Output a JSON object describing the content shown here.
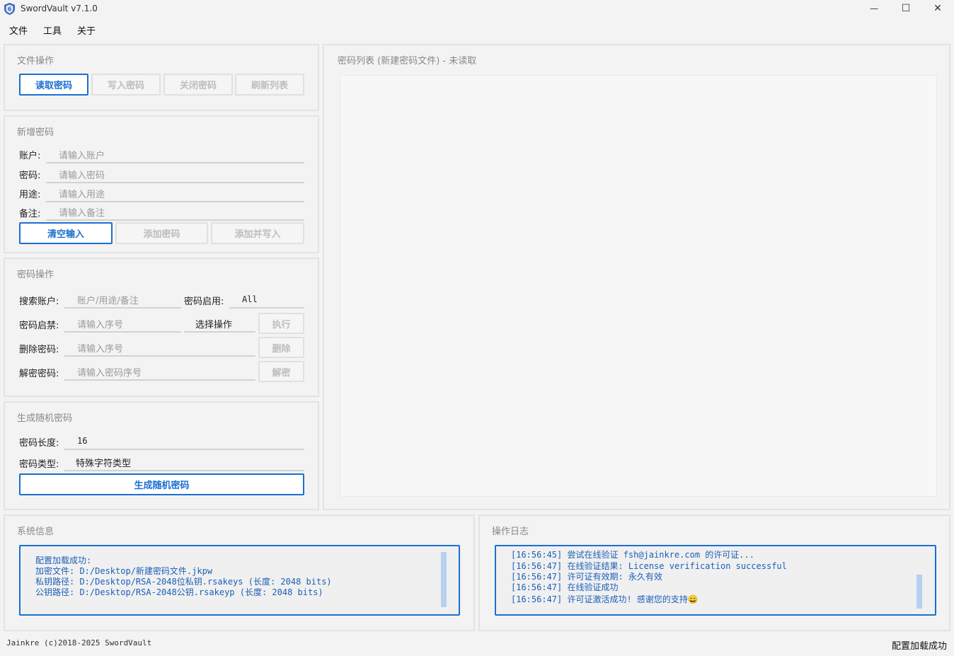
{
  "window": {
    "title": "SwordVault v7.1.0",
    "minimize": "—",
    "maximize": "☐",
    "close": "✕"
  },
  "menu": [
    "文件",
    "工具",
    "关于"
  ],
  "file_ops": {
    "title": "文件操作",
    "buttons": [
      "读取密码",
      "写入密码",
      "关闭密码",
      "刷新列表"
    ]
  },
  "new_password": {
    "title": "新增密码",
    "fields": [
      {
        "label": "账户:",
        "placeholder": "请输入账户"
      },
      {
        "label": "密码:",
        "placeholder": "请输入密码"
      },
      {
        "label": "用途:",
        "placeholder": "请输入用途"
      },
      {
        "label": "备注:",
        "placeholder": "请输入备注"
      }
    ],
    "buttons": [
      "清空输入",
      "添加密码",
      "添加并写入"
    ]
  },
  "password_ops": {
    "title": "密码操作",
    "search_label": "搜索账户:",
    "search_placeholder": "账户/用途/备注",
    "enable_label": "密码启用:",
    "enable_value": "All",
    "toggle_label": "密码启禁:",
    "toggle_placeholder": "请输入序号",
    "select_action": "选择操作",
    "execute": "执行",
    "delete_label": "删除密码:",
    "delete_placeholder": "请输入序号",
    "delete_button": "删除",
    "decrypt_label": "解密密码:",
    "decrypt_placeholder": "请输入密码序号",
    "decrypt_button": "解密"
  },
  "random_password": {
    "title": "生成随机密码",
    "length_label": "密码长度:",
    "length_value": "16",
    "type_label": "密码类型:",
    "type_value": "特殊字符类型",
    "generate": "生成随机密码"
  },
  "password_list": {
    "title": "密码列表 (新建密码文件) - 未读取"
  },
  "system_info": {
    "title": "系统信息",
    "lines": [
      "配置加载成功:",
      "加密文件: D:/Desktop/新建密码文件.jkpw",
      "私钥路径: D:/Desktop/RSA-2048位私钥.rsakeys (长度: 2048 bits)",
      "公钥路径: D:/Desktop/RSA-2048公钥.rsakeyp (长度: 2048 bits)"
    ]
  },
  "operation_log": {
    "title": "操作日志",
    "lines": [
      "[16:56:45] 尝试在线验证 fsh@jainkre.com 的许可证...",
      "[16:56:47] 在线验证结果: License verification successful",
      "[16:56:47] 许可证有效期: 永久有效",
      "[16:56:47] 在线验证成功",
      "[16:56:47] 许可证激活成功! 感谢您的支持😄"
    ]
  },
  "status": {
    "copyright": "Jainkre (c)2018-2025 SwordVault",
    "message": "配置加载成功"
  },
  "colors": {
    "accent": "#1b6fd1",
    "log_text": "#1b5fb8"
  }
}
